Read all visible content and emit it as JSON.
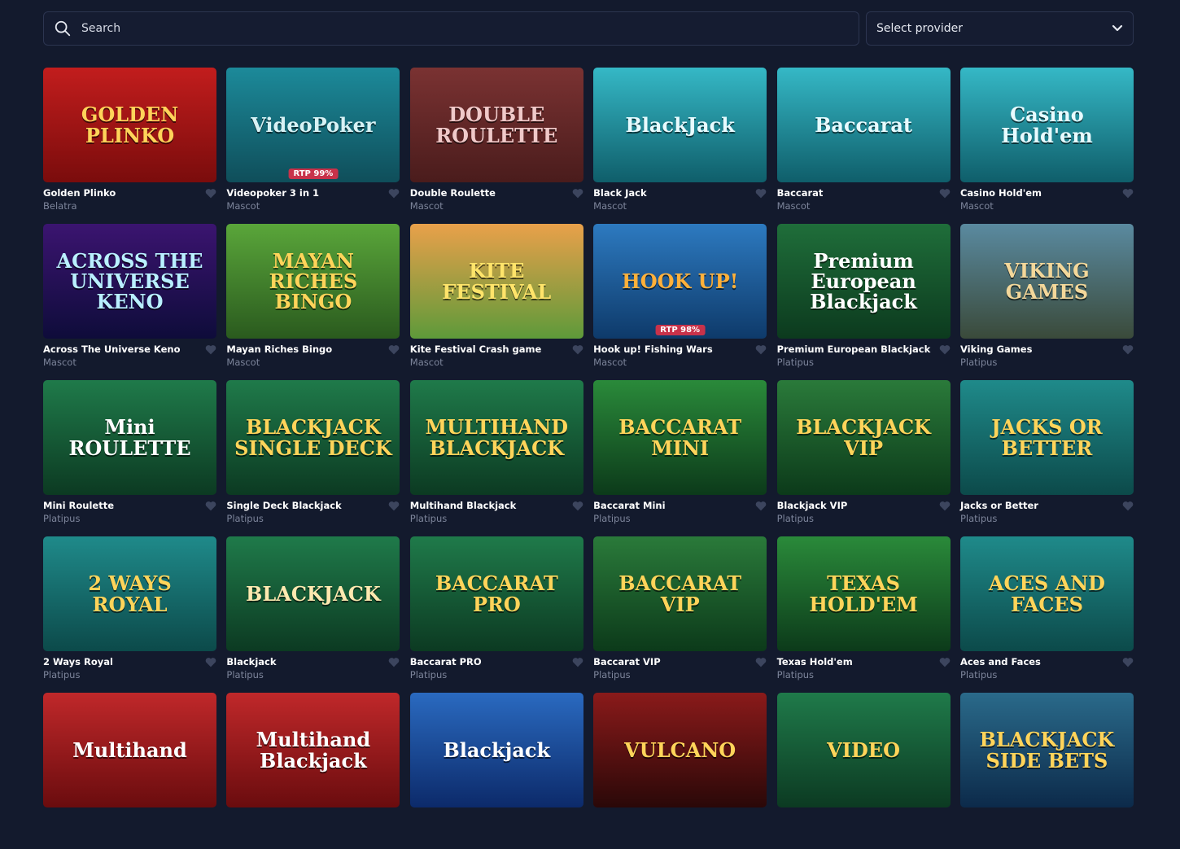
{
  "search": {
    "placeholder": "Search"
  },
  "provider_select": {
    "label": "Select provider"
  },
  "colors": {
    "background": "#131a2d",
    "card_title": "#ffffff",
    "card_provider": "#7d859b",
    "favorite_icon": "#3c455e"
  },
  "games": [
    {
      "title": "Golden Plinko",
      "provider": "Belatra",
      "art": "GOLDEN PLINKO",
      "bg": "linear-gradient(180deg,#c21d1d,#7a0c0c)",
      "fg": "#ffd35a",
      "badge": ""
    },
    {
      "title": "Videopoker 3 in 1",
      "provider": "Mascot",
      "art": "VideoPoker",
      "bg": "linear-gradient(180deg,#1c8a9a,#0f4e5a)",
      "fg": "#d7f2f5",
      "badge": "RTP 99%"
    },
    {
      "title": "Double Roulette",
      "provider": "Mascot",
      "art": "DOUBLE ROULETTE",
      "bg": "linear-gradient(180deg,#7a3232,#4a1c1c)",
      "fg": "#f0c9c9",
      "badge": ""
    },
    {
      "title": "Black Jack",
      "provider": "Mascot",
      "art": "BlackJack",
      "bg": "linear-gradient(180deg,#35b8c6,#0f5e6a)",
      "fg": "#e8fbff",
      "badge": ""
    },
    {
      "title": "Baccarat",
      "provider": "Mascot",
      "art": "Baccarat",
      "bg": "linear-gradient(180deg,#35b8c6,#0f5e6a)",
      "fg": "#e8fbff",
      "badge": ""
    },
    {
      "title": "Casino Hold'em",
      "provider": "Mascot",
      "art": "Casino Hold'em",
      "bg": "linear-gradient(180deg,#35b8c6,#0f5e6a)",
      "fg": "#e8fbff",
      "badge": ""
    },
    {
      "title": "Across The Universe Keno",
      "provider": "Mascot",
      "art": "ACROSS THE UNIVERSE KENO",
      "bg": "linear-gradient(180deg,#3b1470,#0e0c3a)",
      "fg": "#b9f0ff",
      "badge": ""
    },
    {
      "title": "Mayan Riches Bingo",
      "provider": "Mascot",
      "art": "MAYAN RICHES BINGO",
      "bg": "linear-gradient(180deg,#5aa63a,#2a5a1e)",
      "fg": "#ffd45a",
      "badge": ""
    },
    {
      "title": "Kite Festival Crash game",
      "provider": "Mascot",
      "art": "KITE FESTIVAL",
      "bg": "linear-gradient(180deg,#e9a04a,#5e9a3a)",
      "fg": "#ffe46a",
      "badge": ""
    },
    {
      "title": "Hook up! Fishing Wars",
      "provider": "Mascot",
      "art": "HOOK UP!",
      "bg": "linear-gradient(180deg,#2d7ac0,#0e3a6a)",
      "fg": "#ffb03a",
      "badge": "RTP 98%"
    },
    {
      "title": "Premium European Blackjack",
      "provider": "Platipus",
      "art": "Premium European Blackjack",
      "bg": "linear-gradient(180deg,#1f6e3a,#0c3a1e)",
      "fg": "#ffffff",
      "badge": ""
    },
    {
      "title": "Viking Games",
      "provider": "Platipus",
      "art": "VIKING GAMES",
      "bg": "linear-gradient(180deg,#5a8aa0,#3a4a3a)",
      "fg": "#f3d79a",
      "badge": ""
    },
    {
      "title": "Mini Roulette",
      "provider": "Platipus",
      "art": "Mini ROULETTE",
      "bg": "linear-gradient(180deg,#1f7a4a,#0c3a22)",
      "fg": "#ffffff",
      "badge": ""
    },
    {
      "title": "Single Deck Blackjack",
      "provider": "Platipus",
      "art": "BLACKJACK SINGLE DECK",
      "bg": "linear-gradient(180deg,#1f7a4a,#0c3a22)",
      "fg": "#ffd45a",
      "badge": ""
    },
    {
      "title": "Multihand Blackjack",
      "provider": "Platipus",
      "art": "MULTIHAND BLACKJACK",
      "bg": "linear-gradient(180deg,#1f7a4a,#0c3a22)",
      "fg": "#ffd45a",
      "badge": ""
    },
    {
      "title": "Baccarat Mini",
      "provider": "Platipus",
      "art": "BACCARAT MINI",
      "bg": "linear-gradient(180deg,#2a8a3a,#0c3a1a)",
      "fg": "#ffd45a",
      "badge": ""
    },
    {
      "title": "Blackjack VIP",
      "provider": "Platipus",
      "art": "BLACKJACK VIP",
      "bg": "linear-gradient(180deg,#2a7a3a,#0c3a1a)",
      "fg": "#ffd45a",
      "badge": ""
    },
    {
      "title": "Jacks or Better",
      "provider": "Platipus",
      "art": "JACKS OR BETTER",
      "bg": "linear-gradient(180deg,#1f8a8a,#0c4a4a)",
      "fg": "#ffd45a",
      "badge": ""
    },
    {
      "title": "2 Ways Royal",
      "provider": "Platipus",
      "art": "2 WAYS ROYAL",
      "bg": "linear-gradient(180deg,#1f8a8a,#0c4a4a)",
      "fg": "#ffd45a",
      "badge": ""
    },
    {
      "title": "Blackjack",
      "provider": "Platipus",
      "art": "BLACKJACK",
      "bg": "linear-gradient(180deg,#1f7a4a,#0c3a22)",
      "fg": "#ffe9b0",
      "badge": ""
    },
    {
      "title": "Baccarat PRO",
      "provider": "Platipus",
      "art": "BACCARAT PRO",
      "bg": "linear-gradient(180deg,#1f7a4a,#0c3a22)",
      "fg": "#ffd45a",
      "badge": ""
    },
    {
      "title": "Baccarat VIP",
      "provider": "Platipus",
      "art": "BACCARAT VIP",
      "bg": "linear-gradient(180deg,#2a7a3a,#0c3a1a)",
      "fg": "#ffd45a",
      "badge": ""
    },
    {
      "title": "Texas Hold'em",
      "provider": "Platipus",
      "art": "TEXAS HOLD'EM",
      "bg": "linear-gradient(180deg,#2a8a3a,#0c3a1a)",
      "fg": "#ffd45a",
      "badge": ""
    },
    {
      "title": "Aces and Faces",
      "provider": "Platipus",
      "art": "ACES AND FACES",
      "bg": "linear-gradient(180deg,#1f8a8a,#0c4a4a)",
      "fg": "#ffd45a",
      "badge": ""
    },
    {
      "title": "",
      "provider": "",
      "art": "Multihand",
      "bg": "linear-gradient(180deg,#c0282a,#6a0c0e)",
      "fg": "#ffffff",
      "badge": ""
    },
    {
      "title": "",
      "provider": "",
      "art": "Multihand Blackjack",
      "bg": "linear-gradient(180deg,#c0282a,#6a0c0e)",
      "fg": "#ffffff",
      "badge": ""
    },
    {
      "title": "",
      "provider": "",
      "art": "Blackjack",
      "bg": "linear-gradient(180deg,#2a6ac0,#0c2a6a)",
      "fg": "#ffffff",
      "badge": ""
    },
    {
      "title": "",
      "provider": "",
      "art": "VULCANO",
      "bg": "linear-gradient(180deg,#8a1a1a,#2a0808)",
      "fg": "#ffd45a",
      "badge": ""
    },
    {
      "title": "",
      "provider": "",
      "art": "VIDEO",
      "bg": "linear-gradient(180deg,#1f7a4a,#0c3a22)",
      "fg": "#ffd45a",
      "badge": ""
    },
    {
      "title": "",
      "provider": "",
      "art": "BLACKJACK SIDE BETS",
      "bg": "linear-gradient(180deg,#2a6a8a,#0c2a4a)",
      "fg": "#ffd45a",
      "badge": ""
    }
  ]
}
